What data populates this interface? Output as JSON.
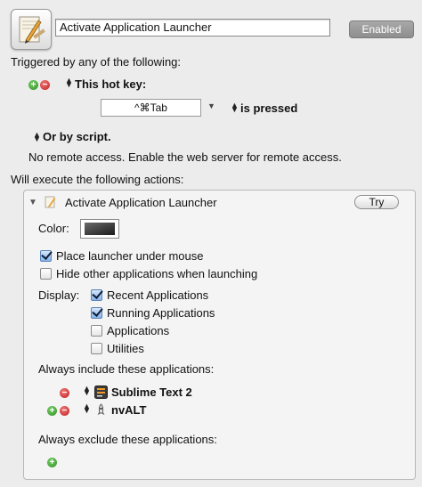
{
  "header": {
    "macro_name": "Activate Application Launcher",
    "enabled_label": "Enabled"
  },
  "triggers": {
    "heading": "Triggered by any of the following:",
    "hot_key_label": "This hot key:",
    "hot_key_value": "^⌘Tab",
    "pressed_label": "is pressed",
    "script_label": "Or by script.",
    "remote_note": "No remote access.  Enable the web server for remote access."
  },
  "actions": {
    "heading": "Will execute the following actions:",
    "action_title": "Activate Application Launcher",
    "try_label": "Try",
    "color_label": "Color:",
    "place_under_mouse": {
      "label": "Place launcher under mouse",
      "checked": true
    },
    "hide_others": {
      "label": "Hide other applications when launching",
      "checked": false
    },
    "display_label": "Display:",
    "display_options": [
      {
        "label": "Recent Applications",
        "checked": true
      },
      {
        "label": "Running Applications",
        "checked": true
      },
      {
        "label": "Applications",
        "checked": false
      },
      {
        "label": "Utilities",
        "checked": false
      }
    ],
    "include_heading": "Always include these applications:",
    "included_apps": [
      {
        "name": "Sublime Text 2",
        "icon": "sublime-text-icon"
      },
      {
        "name": "nvALT",
        "icon": "nvalt-rocket-icon"
      }
    ],
    "exclude_heading": "Always exclude these applications:"
  }
}
